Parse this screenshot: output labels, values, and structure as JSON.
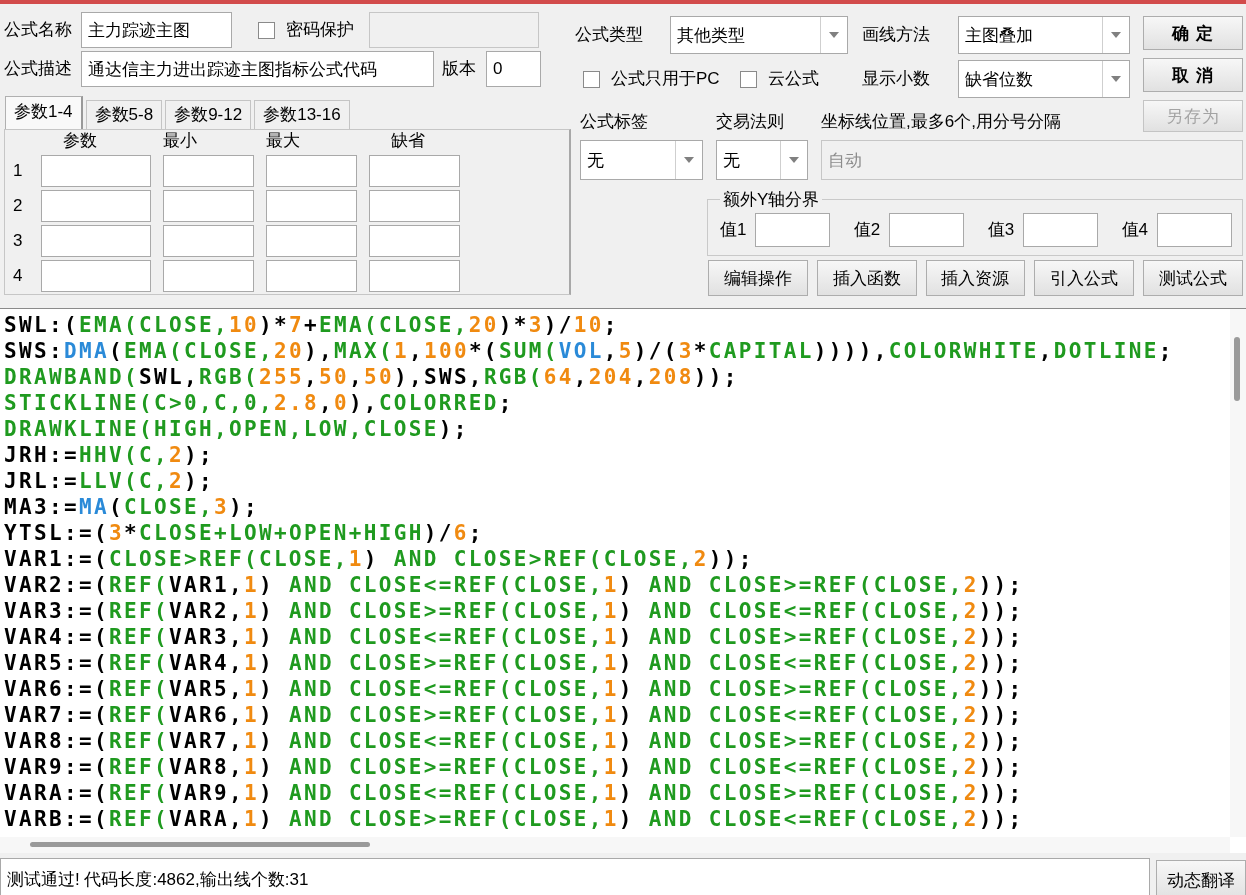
{
  "formula": {
    "name": {
      "label": "公式名称",
      "value": "主力踪迹主图"
    },
    "password": {
      "label": "密码保护",
      "checked": false
    },
    "description": {
      "label": "公式描述",
      "value": "通达信主力进出踪迹主图指标公式代码"
    },
    "version": {
      "label": "版本",
      "value": "0"
    }
  },
  "param_tabs": [
    {
      "label": "参数1-4",
      "selected": true
    },
    {
      "label": "参数5-8",
      "selected": false
    },
    {
      "label": "参数9-12",
      "selected": false
    },
    {
      "label": "参数13-16",
      "selected": false
    }
  ],
  "param_columns": [
    "参数",
    "最小",
    "最大",
    "缺省"
  ],
  "param_rows": [
    "1",
    "2",
    "3",
    "4"
  ],
  "settings": {
    "type": {
      "label": "公式类型",
      "value": "其他类型"
    },
    "draw_method": {
      "label": "画线方法",
      "value": "主图叠加"
    },
    "pc_only": {
      "label": "公式只用于PC",
      "checked": false
    },
    "cloud": {
      "label": "云公式",
      "checked": false
    },
    "decimals": {
      "label": "显示小数",
      "value": "缺省位数"
    },
    "tag": {
      "label": "公式标签",
      "value": "无"
    },
    "trade_rule": {
      "label": "交易法则",
      "value": "无"
    },
    "axis_lines": {
      "label": "坐标线位置,最多6个,用分号分隔",
      "value": "自动",
      "disabled": true
    }
  },
  "side_buttons": [
    {
      "label": "确 定",
      "disabled": false
    },
    {
      "label": "取 消",
      "disabled": false
    },
    {
      "label": "另存为",
      "disabled": true
    }
  ],
  "y_bounds": {
    "title": "额外Y轴分界",
    "fields": [
      "值1",
      "值2",
      "值3",
      "值4"
    ]
  },
  "tool_buttons": [
    "编辑操作",
    "插入函数",
    "插入资源",
    "引入公式",
    "测试公式"
  ],
  "code_lines": [
    {
      "segments": [
        {
          "text": "SWL:(",
          "kind": "plain"
        },
        {
          "text": "EMA(CLOSE,",
          "kind": "function"
        },
        {
          "text": "10",
          "kind": "number"
        },
        {
          "text": ")*",
          "kind": "plain"
        },
        {
          "text": "7",
          "kind": "number"
        },
        {
          "text": "+",
          "kind": "plain"
        },
        {
          "text": "EMA(CLOSE,",
          "kind": "function"
        },
        {
          "text": "20",
          "kind": "number"
        },
        {
          "text": ")*",
          "kind": "plain"
        },
        {
          "text": "3",
          "kind": "number"
        },
        {
          "text": ")/",
          "kind": "plain"
        },
        {
          "text": "10",
          "kind": "number"
        },
        {
          "text": ";",
          "kind": "plain"
        }
      ]
    },
    {
      "segments": [
        {
          "text": "SWS:",
          "kind": "plain"
        },
        {
          "text": "DMA",
          "kind": "builtin"
        },
        {
          "text": "(",
          "kind": "plain"
        },
        {
          "text": "EMA(CLOSE,",
          "kind": "function"
        },
        {
          "text": "20",
          "kind": "number"
        },
        {
          "text": "),",
          "kind": "plain"
        },
        {
          "text": "MAX(",
          "kind": "function"
        },
        {
          "text": "1",
          "kind": "number"
        },
        {
          "text": ",",
          "kind": "plain"
        },
        {
          "text": "100",
          "kind": "number"
        },
        {
          "text": "*(",
          "kind": "plain"
        },
        {
          "text": "SUM(",
          "kind": "function"
        },
        {
          "text": "VOL",
          "kind": "builtin"
        },
        {
          "text": ",",
          "kind": "plain"
        },
        {
          "text": "5",
          "kind": "number"
        },
        {
          "text": ")/(",
          "kind": "plain"
        },
        {
          "text": "3",
          "kind": "number"
        },
        {
          "text": "*",
          "kind": "plain"
        },
        {
          "text": "CAPITAL",
          "kind": "function"
        },
        {
          "text": ")))),",
          "kind": "plain"
        },
        {
          "text": "COLORWHITE",
          "kind": "function"
        },
        {
          "text": ",",
          "kind": "plain"
        },
        {
          "text": "DOTLINE",
          "kind": "function"
        },
        {
          "text": ";",
          "kind": "plain"
        }
      ]
    },
    {
      "segments": [
        {
          "text": "DRAWBAND(",
          "kind": "function"
        },
        {
          "text": "SWL,",
          "kind": "plain"
        },
        {
          "text": "RGB(",
          "kind": "function"
        },
        {
          "text": "255",
          "kind": "number"
        },
        {
          "text": ",",
          "kind": "plain"
        },
        {
          "text": "50",
          "kind": "number"
        },
        {
          "text": ",",
          "kind": "plain"
        },
        {
          "text": "50",
          "kind": "number"
        },
        {
          "text": "),SWS,",
          "kind": "plain"
        },
        {
          "text": "RGB(",
          "kind": "function"
        },
        {
          "text": "64",
          "kind": "number"
        },
        {
          "text": ",",
          "kind": "plain"
        },
        {
          "text": "204",
          "kind": "number"
        },
        {
          "text": ",",
          "kind": "plain"
        },
        {
          "text": "208",
          "kind": "number"
        },
        {
          "text": "));",
          "kind": "plain"
        }
      ]
    },
    {
      "segments": [
        {
          "text": "STICKLINE(C>0,C,0,",
          "kind": "function"
        },
        {
          "text": "2.8",
          "kind": "number"
        },
        {
          "text": ",",
          "kind": "plain"
        },
        {
          "text": "0",
          "kind": "number"
        },
        {
          "text": "),",
          "kind": "plain"
        },
        {
          "text": "COLORRED",
          "kind": "function"
        },
        {
          "text": ";",
          "kind": "plain"
        }
      ]
    },
    {
      "segments": [
        {
          "text": "DRAWKLINE(HIGH,OPEN,LOW,CLOSE",
          "kind": "function"
        },
        {
          "text": ");",
          "kind": "plain"
        }
      ]
    },
    {
      "segments": [
        {
          "text": "JRH:=",
          "kind": "plain"
        },
        {
          "text": "HHV(C,",
          "kind": "function"
        },
        {
          "text": "2",
          "kind": "number"
        },
        {
          "text": ");",
          "kind": "plain"
        }
      ]
    },
    {
      "segments": [
        {
          "text": "JRL:=",
          "kind": "plain"
        },
        {
          "text": "LLV(C,",
          "kind": "function"
        },
        {
          "text": "2",
          "kind": "number"
        },
        {
          "text": ");",
          "kind": "plain"
        }
      ]
    },
    {
      "segments": [
        {
          "text": "MA3:=",
          "kind": "plain"
        },
        {
          "text": "MA",
          "kind": "builtin"
        },
        {
          "text": "(",
          "kind": "plain"
        },
        {
          "text": "CLOSE,",
          "kind": "function"
        },
        {
          "text": "3",
          "kind": "number"
        },
        {
          "text": ");",
          "kind": "plain"
        }
      ]
    },
    {
      "segments": [
        {
          "text": "YTSL:=(",
          "kind": "plain"
        },
        {
          "text": "3",
          "kind": "number"
        },
        {
          "text": "*",
          "kind": "plain"
        },
        {
          "text": "CLOSE+LOW+OPEN+HIGH",
          "kind": "function"
        },
        {
          "text": ")/",
          "kind": "plain"
        },
        {
          "text": "6",
          "kind": "number"
        },
        {
          "text": ";",
          "kind": "plain"
        }
      ]
    },
    {
      "segments": [
        {
          "text": "VAR1:=(",
          "kind": "plain"
        },
        {
          "text": "CLOSE>REF(CLOSE,",
          "kind": "function"
        },
        {
          "text": "1",
          "kind": "number"
        },
        {
          "text": ") ",
          "kind": "plain"
        },
        {
          "text": "AND CLOSE>REF(CLOSE,",
          "kind": "function"
        },
        {
          "text": "2",
          "kind": "number"
        },
        {
          "text": "));",
          "kind": "plain"
        }
      ]
    },
    {
      "segments": [
        {
          "text": "VAR2:=(",
          "kind": "plain"
        },
        {
          "text": "REF(",
          "kind": "function"
        },
        {
          "text": "VAR1,",
          "kind": "plain"
        },
        {
          "text": "1",
          "kind": "number"
        },
        {
          "text": ") ",
          "kind": "plain"
        },
        {
          "text": "AND CLOSE<=REF(CLOSE,",
          "kind": "function"
        },
        {
          "text": "1",
          "kind": "number"
        },
        {
          "text": ") ",
          "kind": "plain"
        },
        {
          "text": "AND CLOSE>=REF(CLOSE,",
          "kind": "function"
        },
        {
          "text": "2",
          "kind": "number"
        },
        {
          "text": "));",
          "kind": "plain"
        }
      ]
    },
    {
      "segments": [
        {
          "text": "VAR3:=(",
          "kind": "plain"
        },
        {
          "text": "REF(",
          "kind": "function"
        },
        {
          "text": "VAR2,",
          "kind": "plain"
        },
        {
          "text": "1",
          "kind": "number"
        },
        {
          "text": ") ",
          "kind": "plain"
        },
        {
          "text": "AND CLOSE>=REF(CLOSE,",
          "kind": "function"
        },
        {
          "text": "1",
          "kind": "number"
        },
        {
          "text": ") ",
          "kind": "plain"
        },
        {
          "text": "AND CLOSE<=REF(CLOSE,",
          "kind": "function"
        },
        {
          "text": "2",
          "kind": "number"
        },
        {
          "text": "));",
          "kind": "plain"
        }
      ]
    },
    {
      "segments": [
        {
          "text": "VAR4:=(",
          "kind": "plain"
        },
        {
          "text": "REF(",
          "kind": "function"
        },
        {
          "text": "VAR3,",
          "kind": "plain"
        },
        {
          "text": "1",
          "kind": "number"
        },
        {
          "text": ") ",
          "kind": "plain"
        },
        {
          "text": "AND CLOSE<=REF(CLOSE,",
          "kind": "function"
        },
        {
          "text": "1",
          "kind": "number"
        },
        {
          "text": ") ",
          "kind": "plain"
        },
        {
          "text": "AND CLOSE>=REF(CLOSE,",
          "kind": "function"
        },
        {
          "text": "2",
          "kind": "number"
        },
        {
          "text": "));",
          "kind": "plain"
        }
      ]
    },
    {
      "segments": [
        {
          "text": "VAR5:=(",
          "kind": "plain"
        },
        {
          "text": "REF(",
          "kind": "function"
        },
        {
          "text": "VAR4,",
          "kind": "plain"
        },
        {
          "text": "1",
          "kind": "number"
        },
        {
          "text": ") ",
          "kind": "plain"
        },
        {
          "text": "AND CLOSE>=REF(CLOSE,",
          "kind": "function"
        },
        {
          "text": "1",
          "kind": "number"
        },
        {
          "text": ") ",
          "kind": "plain"
        },
        {
          "text": "AND CLOSE<=REF(CLOSE,",
          "kind": "function"
        },
        {
          "text": "2",
          "kind": "number"
        },
        {
          "text": "));",
          "kind": "plain"
        }
      ]
    },
    {
      "segments": [
        {
          "text": "VAR6:=(",
          "kind": "plain"
        },
        {
          "text": "REF(",
          "kind": "function"
        },
        {
          "text": "VAR5,",
          "kind": "plain"
        },
        {
          "text": "1",
          "kind": "number"
        },
        {
          "text": ") ",
          "kind": "plain"
        },
        {
          "text": "AND CLOSE<=REF(CLOSE,",
          "kind": "function"
        },
        {
          "text": "1",
          "kind": "number"
        },
        {
          "text": ") ",
          "kind": "plain"
        },
        {
          "text": "AND CLOSE>=REF(CLOSE,",
          "kind": "function"
        },
        {
          "text": "2",
          "kind": "number"
        },
        {
          "text": "));",
          "kind": "plain"
        }
      ]
    },
    {
      "segments": [
        {
          "text": "VAR7:=(",
          "kind": "plain"
        },
        {
          "text": "REF(",
          "kind": "function"
        },
        {
          "text": "VAR6,",
          "kind": "plain"
        },
        {
          "text": "1",
          "kind": "number"
        },
        {
          "text": ") ",
          "kind": "plain"
        },
        {
          "text": "AND CLOSE>=REF(CLOSE,",
          "kind": "function"
        },
        {
          "text": "1",
          "kind": "number"
        },
        {
          "text": ") ",
          "kind": "plain"
        },
        {
          "text": "AND CLOSE<=REF(CLOSE,",
          "kind": "function"
        },
        {
          "text": "2",
          "kind": "number"
        },
        {
          "text": "));",
          "kind": "plain"
        }
      ]
    },
    {
      "segments": [
        {
          "text": "VAR8:=(",
          "kind": "plain"
        },
        {
          "text": "REF(",
          "kind": "function"
        },
        {
          "text": "VAR7,",
          "kind": "plain"
        },
        {
          "text": "1",
          "kind": "number"
        },
        {
          "text": ") ",
          "kind": "plain"
        },
        {
          "text": "AND CLOSE<=REF(CLOSE,",
          "kind": "function"
        },
        {
          "text": "1",
          "kind": "number"
        },
        {
          "text": ") ",
          "kind": "plain"
        },
        {
          "text": "AND CLOSE>=REF(CLOSE,",
          "kind": "function"
        },
        {
          "text": "2",
          "kind": "number"
        },
        {
          "text": "));",
          "kind": "plain"
        }
      ]
    },
    {
      "segments": [
        {
          "text": "VAR9:=(",
          "kind": "plain"
        },
        {
          "text": "REF(",
          "kind": "function"
        },
        {
          "text": "VAR8,",
          "kind": "plain"
        },
        {
          "text": "1",
          "kind": "number"
        },
        {
          "text": ") ",
          "kind": "plain"
        },
        {
          "text": "AND CLOSE>=REF(CLOSE,",
          "kind": "function"
        },
        {
          "text": "1",
          "kind": "number"
        },
        {
          "text": ") ",
          "kind": "plain"
        },
        {
          "text": "AND CLOSE<=REF(CLOSE,",
          "kind": "function"
        },
        {
          "text": "2",
          "kind": "number"
        },
        {
          "text": "));",
          "kind": "plain"
        }
      ]
    },
    {
      "segments": [
        {
          "text": "VARA:=(",
          "kind": "plain"
        },
        {
          "text": "REF(",
          "kind": "function"
        },
        {
          "text": "VAR9,",
          "kind": "plain"
        },
        {
          "text": "1",
          "kind": "number"
        },
        {
          "text": ") ",
          "kind": "plain"
        },
        {
          "text": "AND CLOSE<=REF(CLOSE,",
          "kind": "function"
        },
        {
          "text": "1",
          "kind": "number"
        },
        {
          "text": ") ",
          "kind": "plain"
        },
        {
          "text": "AND CLOSE>=REF(CLOSE,",
          "kind": "function"
        },
        {
          "text": "2",
          "kind": "number"
        },
        {
          "text": "));",
          "kind": "plain"
        }
      ]
    },
    {
      "segments": [
        {
          "text": "VARB:=(",
          "kind": "plain"
        },
        {
          "text": "REF(",
          "kind": "function"
        },
        {
          "text": "VARA,",
          "kind": "plain"
        },
        {
          "text": "1",
          "kind": "number"
        },
        {
          "text": ") ",
          "kind": "plain"
        },
        {
          "text": "AND CLOSE>=REF(CLOSE,",
          "kind": "function"
        },
        {
          "text": "1",
          "kind": "number"
        },
        {
          "text": ") ",
          "kind": "plain"
        },
        {
          "text": "AND CLOSE<=REF(CLOSE,",
          "kind": "function"
        },
        {
          "text": "2",
          "kind": "number"
        },
        {
          "text": "));",
          "kind": "plain"
        }
      ]
    }
  ],
  "status": {
    "message": "测试通过! 代码长度:4862,输出线个数:31",
    "button": "动态翻译"
  }
}
